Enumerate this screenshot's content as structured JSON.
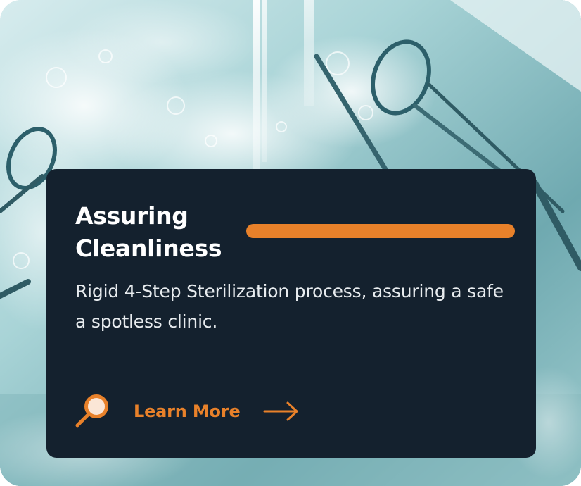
{
  "card": {
    "title": "Assuring Cleanliness",
    "description": "Rigid 4-Step Sterilization process, assuring a safe a spotless clinic.",
    "cta_label": "Learn More",
    "icons": {
      "cta_leading": "magnifying-glass-icon",
      "cta_trailing": "arrow-right-icon"
    }
  },
  "colors": {
    "panel": "#14212e",
    "accent": "#e8812a",
    "title": "#ffffff",
    "text": "#e8ecef"
  }
}
